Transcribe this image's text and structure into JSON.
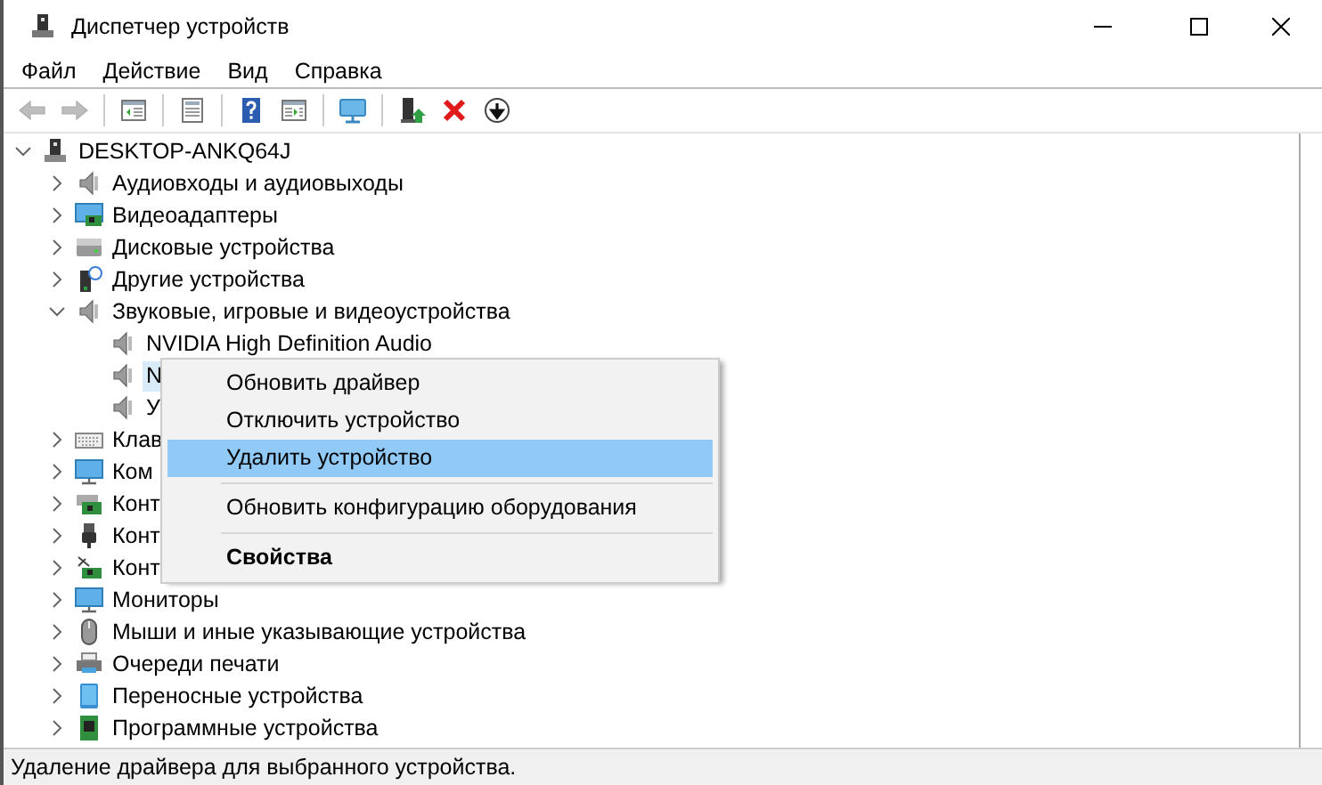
{
  "window": {
    "title": "Диспетчер устройств"
  },
  "menu_bar": [
    "Файл",
    "Действие",
    "Вид",
    "Справка"
  ],
  "toolbar": [
    {
      "kind": "back",
      "disabled": true
    },
    {
      "kind": "forward",
      "disabled": true
    },
    {
      "kind": "separator"
    },
    {
      "kind": "console-tree",
      "disabled": false
    },
    {
      "kind": "separator"
    },
    {
      "kind": "properties",
      "disabled": false
    },
    {
      "kind": "separator"
    },
    {
      "kind": "help",
      "disabled": false
    },
    {
      "kind": "action-pane",
      "disabled": false
    },
    {
      "kind": "separator"
    },
    {
      "kind": "scan",
      "disabled": false
    },
    {
      "kind": "separator"
    },
    {
      "kind": "update",
      "disabled": false
    },
    {
      "kind": "remove",
      "disabled": false
    },
    {
      "kind": "download",
      "disabled": false
    }
  ],
  "tree": [
    {
      "label": "DESKTOP-ANKQ64J",
      "kind": "computer",
      "expanded": true,
      "selected": false,
      "children": [
        {
          "label": "Аудиовходы и аудиовыходы",
          "kind": "speaker",
          "expanded": false,
          "selected": false
        },
        {
          "label": "Видеоадаптеры",
          "kind": "display",
          "expanded": false,
          "selected": false
        },
        {
          "label": "Дисковые устройства",
          "kind": "disk",
          "expanded": false,
          "selected": false
        },
        {
          "label": "Другие устройства",
          "kind": "unknown",
          "expanded": false,
          "selected": false
        },
        {
          "label": "Звуковые, игровые и видеоустройства",
          "kind": "speaker",
          "expanded": true,
          "selected": false,
          "children": [
            {
              "label": "NVIDIA High Definition Audio",
              "kind": "speaker",
              "selected": false
            },
            {
              "label": "N",
              "kind": "speaker",
              "selected": true
            },
            {
              "label": "У",
              "kind": "speaker",
              "selected": false
            }
          ]
        },
        {
          "label": "Клав",
          "kind": "keyboard",
          "expanded": false,
          "selected": false
        },
        {
          "label": "Ком",
          "kind": "monitor",
          "expanded": false,
          "selected": false
        },
        {
          "label": "Конт",
          "kind": "board",
          "expanded": false,
          "selected": false
        },
        {
          "label": "Конт",
          "kind": "usb",
          "expanded": false,
          "selected": false
        },
        {
          "label": "Конт",
          "kind": "storage",
          "expanded": false,
          "selected": false
        },
        {
          "label": "Мониторы",
          "kind": "monitor",
          "expanded": false,
          "selected": false
        },
        {
          "label": "Мыши и иные указывающие устройства",
          "kind": "mouse",
          "expanded": false,
          "selected": false
        },
        {
          "label": "Очереди печати",
          "kind": "printer",
          "expanded": false,
          "selected": false
        },
        {
          "label": "Переносные устройства",
          "kind": "portable",
          "expanded": false,
          "selected": false
        },
        {
          "label": "Программные устройства",
          "kind": "software",
          "expanded": false,
          "selected": false
        }
      ]
    }
  ],
  "context_menu": [
    {
      "kind": "item",
      "label": "Обновить драйвер",
      "selected": false,
      "default": false
    },
    {
      "kind": "item",
      "label": "Отключить устройство",
      "selected": false,
      "default": false
    },
    {
      "kind": "item",
      "label": "Удалить устройство",
      "selected": true,
      "default": false
    },
    {
      "kind": "separator"
    },
    {
      "kind": "item",
      "label": "Обновить конфигурацию оборудования",
      "selected": false,
      "default": false
    },
    {
      "kind": "separator"
    },
    {
      "kind": "item",
      "label": "Свойства",
      "selected": false,
      "default": true
    }
  ],
  "status_bar": "Удаление драйвера для выбранного устройства."
}
